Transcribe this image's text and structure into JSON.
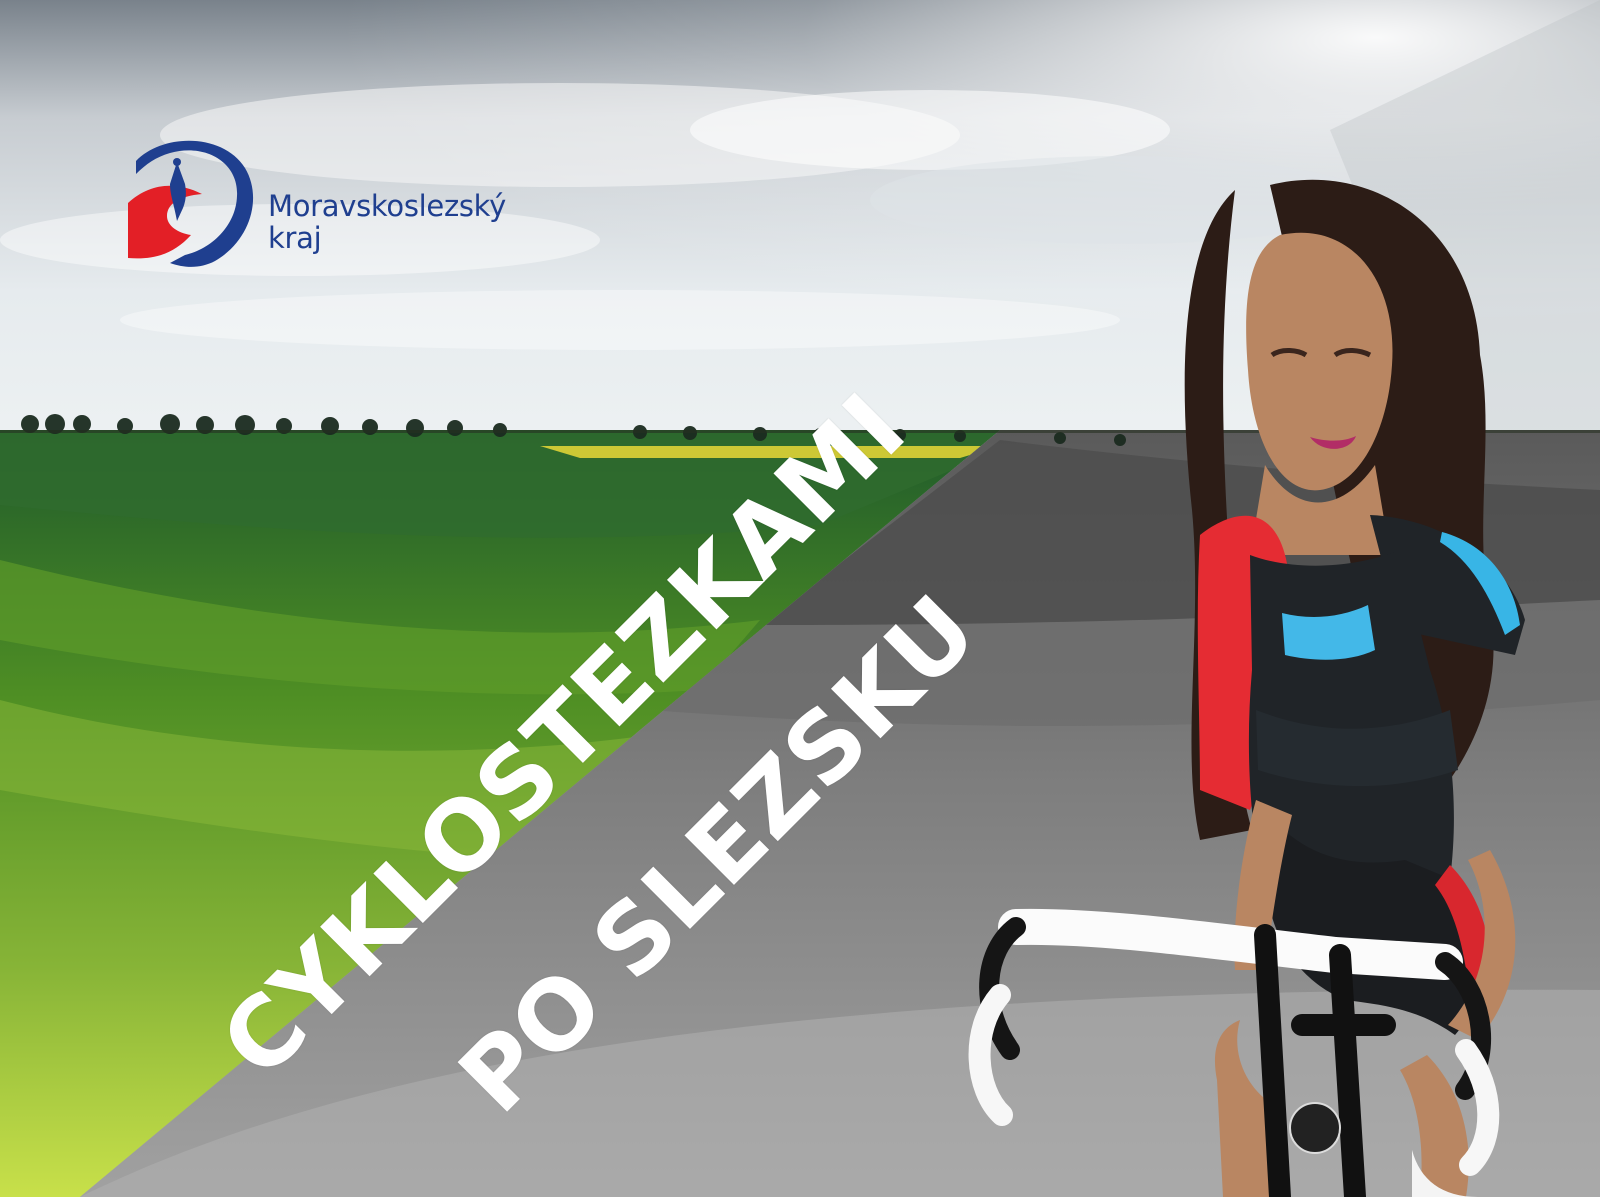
{
  "brand": {
    "name_line1": "Moravskoslezský",
    "name_line2": "kraj",
    "colors": {
      "blue": "#1f3f8f",
      "red": "#e31f26"
    },
    "icon": "regional-logo-icon"
  },
  "headline": {
    "line1": "CYKLOSTEZKAMI",
    "line2": "PO SLEZSKU",
    "color": "#ffffff"
  },
  "scene": {
    "left_palette": "green-fields",
    "right_palette": "grayscale",
    "subject": "cyclist-with-road-bike"
  }
}
